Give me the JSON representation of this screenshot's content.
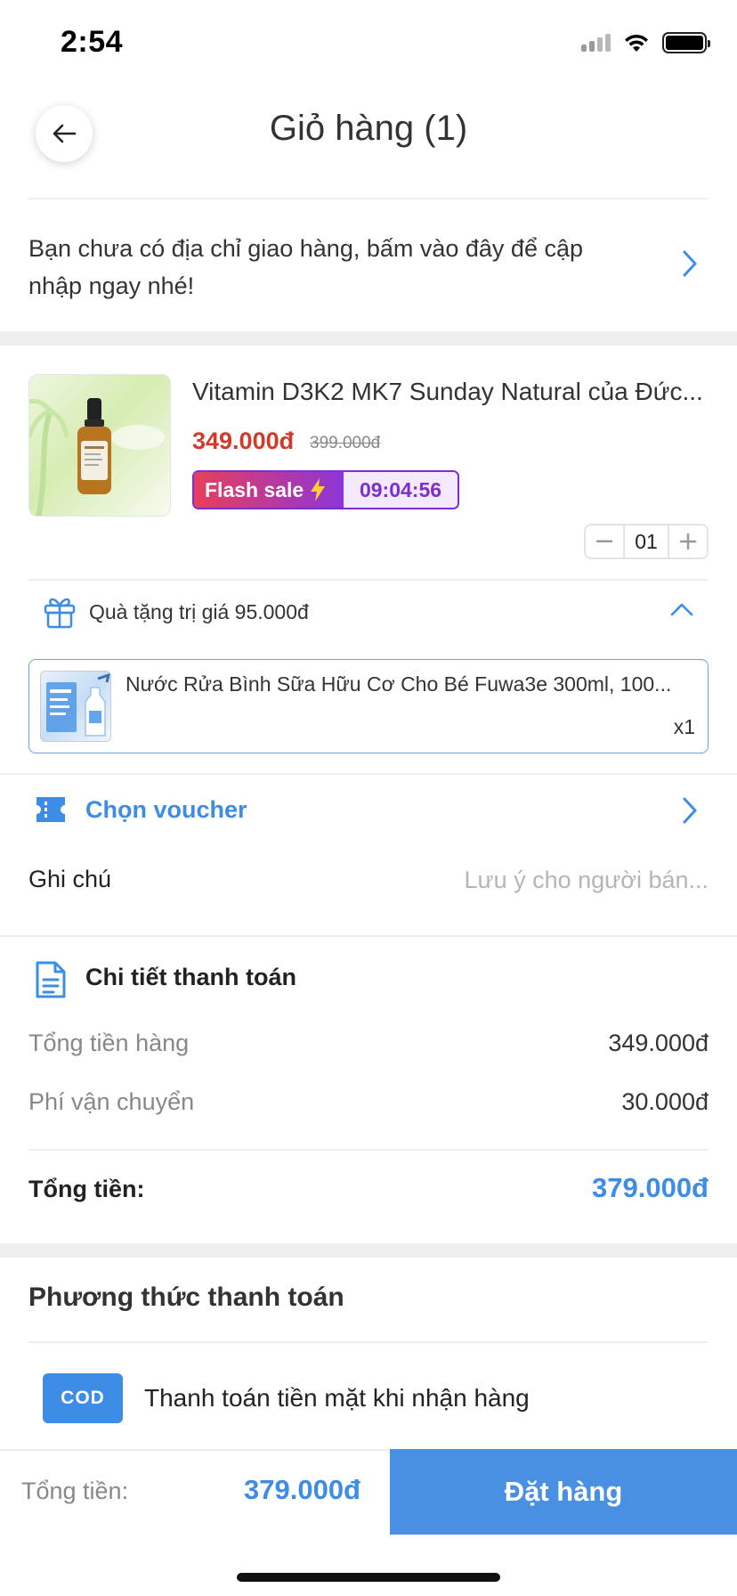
{
  "status_bar": {
    "time": "2:54"
  },
  "header": {
    "title": "Giỏ hàng (1)"
  },
  "address": {
    "text": "Bạn chưa có địa chỉ giao hàng, bấm vào đây để cập nhập ngay nhé!"
  },
  "product": {
    "name": "Vitamin D3K2 MK7 Sunday Natural của Đức...",
    "price": "349.000đ",
    "old_price": "399.000đ",
    "flash_sale_label": "Flash sale",
    "flash_timer": "09:04:56",
    "quantity": "01"
  },
  "gift": {
    "label": "Quà tặng trị giá 95.000đ",
    "item_name": "Nước Rửa Bình Sữa Hữu Cơ Cho Bé Fuwa3e 300ml, 100...",
    "item_qty": "x1"
  },
  "voucher": {
    "label": "Chọn voucher"
  },
  "note": {
    "label": "Ghi chú",
    "placeholder": "Lưu ý cho người bán..."
  },
  "payment_detail": {
    "title": "Chi tiết thanh toán",
    "rows": [
      {
        "label": "Tổng tiền hàng",
        "value": "349.000đ"
      },
      {
        "label": "Phí vận chuyển",
        "value": "30.000đ"
      }
    ],
    "total_label": "Tổng tiền:",
    "total_value": "379.000đ"
  },
  "payment_method": {
    "title": "Phương thức thanh toán",
    "badge": "COD",
    "text": "Thanh toán tiền mặt khi nhận hàng"
  },
  "bottom_bar": {
    "total_label": "Tổng tiền:",
    "total_value": "379.000đ",
    "order_button": "Đặt hàng"
  },
  "colors": {
    "accent": "#3d8de6",
    "price_red": "#d13a2b",
    "flash_purple": "#7b2fd0"
  }
}
